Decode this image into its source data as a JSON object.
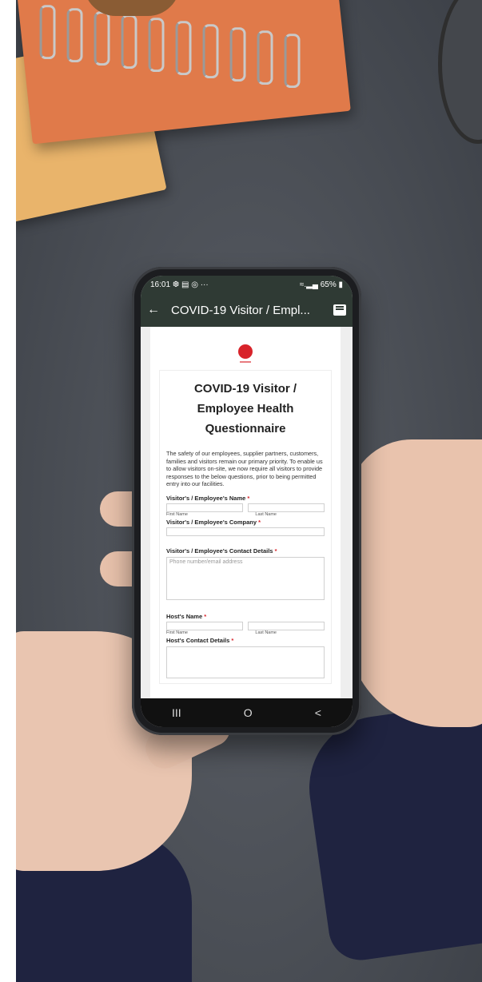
{
  "status": {
    "time": "16:01",
    "notifications": "❆ ▤ ◎ ···",
    "battery": "65%"
  },
  "appbar": {
    "back_icon": "arrow-left-icon",
    "title": "COVID-19 Visitor / Empl...",
    "chat_icon": "chat-icon"
  },
  "form": {
    "title": "COVID-19 Visitor / Employee Health Questionnaire",
    "intro": "The safety of our employees, supplier partners, customers, families and visitors remain our primary priority. To enable us to allow visitors on-site, we now require all visitors to provide responses to the below questions, prior to being permitted entry into our facilities.",
    "name_label": "Visitor's / Employee's Name",
    "first_name": "First Name",
    "last_name": "Last Name",
    "company_label": "Visitor's / Employee's Company",
    "contact_label": "Visitor's / Employee's Contact Details",
    "contact_placeholder": "Phone number/email address",
    "host_name_label": "Host's Name",
    "host_first": "First Name",
    "host_last": "Last Name",
    "host_contact_label": "Host's Contact Details",
    "required_mark": "*"
  },
  "navbar": {
    "recents": "III",
    "home": "O",
    "back": "<"
  }
}
